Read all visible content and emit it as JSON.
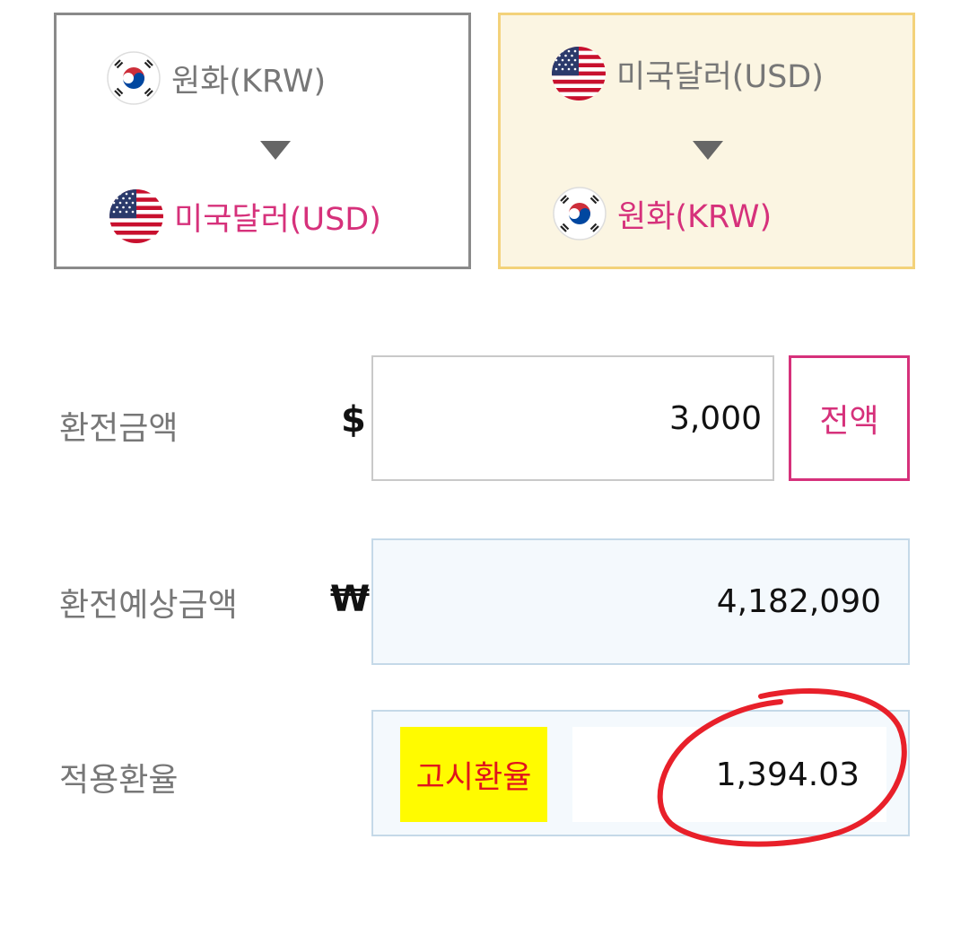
{
  "direction_cards": [
    {
      "from": {
        "label": "원화(KRW)",
        "flag": "korea-flag-icon"
      },
      "to": {
        "label": "미국달러(USD)",
        "flag": "usa-flag-icon"
      },
      "arrow": "down-triangle-icon",
      "selected": false
    },
    {
      "from": {
        "label": "미국달러(USD)",
        "flag": "usa-flag-icon"
      },
      "to": {
        "label": "원화(KRW)",
        "flag": "korea-flag-icon"
      },
      "arrow": "down-triangle-icon",
      "selected": true
    }
  ],
  "exchange_amount": {
    "label": "환전금액",
    "currency_symbol": "$",
    "value": "3,000",
    "full_button": "전액"
  },
  "expected_amount": {
    "label": "환전예상금액",
    "currency_symbol": "₩",
    "value": "4,182,090"
  },
  "applied_rate": {
    "label": "적용환율",
    "badge": "고시환율",
    "value": "1,394.03"
  },
  "colors": {
    "accent": "#d6317b",
    "selected_card_bg": "#fbf5e2",
    "selected_card_border": "#f3d27a",
    "badge_bg": "#fffb00",
    "badge_text": "#e0141c",
    "highlight_circle": "#e8202a"
  }
}
